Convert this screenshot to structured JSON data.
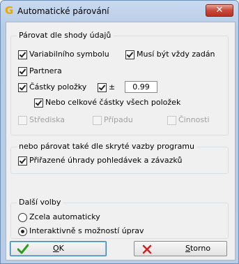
{
  "window": {
    "title": "Automatické párování",
    "app_icon_glyph": "G",
    "close_glyph": "✕"
  },
  "match_group": {
    "legend": "Párovat dle shody údajů",
    "variable_symbol": {
      "label": "Variabilního symbolu",
      "checked": true
    },
    "must_be_set": {
      "label": "Musí být vždy zadán",
      "checked": true
    },
    "partner": {
      "label": "Partnera",
      "checked": true
    },
    "item_amount": {
      "label": "Částky položky",
      "checked": true
    },
    "tolerance": {
      "label": "±",
      "checked": true,
      "value": "0.99"
    },
    "total_amount": {
      "label": "Nebo celkové částky všech položek",
      "checked": true
    },
    "center": {
      "label": "Střediska",
      "checked": false,
      "disabled": true
    },
    "case": {
      "label": "Případu",
      "checked": false,
      "disabled": true
    },
    "activity": {
      "label": "Činnosti",
      "checked": false,
      "disabled": true
    }
  },
  "hidden_group": {
    "legend": "nebo párovat také dle skryté vazby programu",
    "assigned": {
      "label": "Přiřazené úhrady pohledávek a závazků",
      "checked": true
    }
  },
  "more_group": {
    "legend": "Další volby",
    "auto": {
      "label": "Zcela automaticky",
      "selected": false
    },
    "interactive": {
      "label": "Interaktivně s možností úprav",
      "selected": true
    }
  },
  "buttons": {
    "ok_accel": "O",
    "ok_rest": "K",
    "cancel_accel": "S",
    "cancel_rest": "torno"
  },
  "colors": {
    "ok_icon": "#2e9b1f",
    "cancel_icon": "#d42020",
    "title_icon": "#e8a800"
  }
}
